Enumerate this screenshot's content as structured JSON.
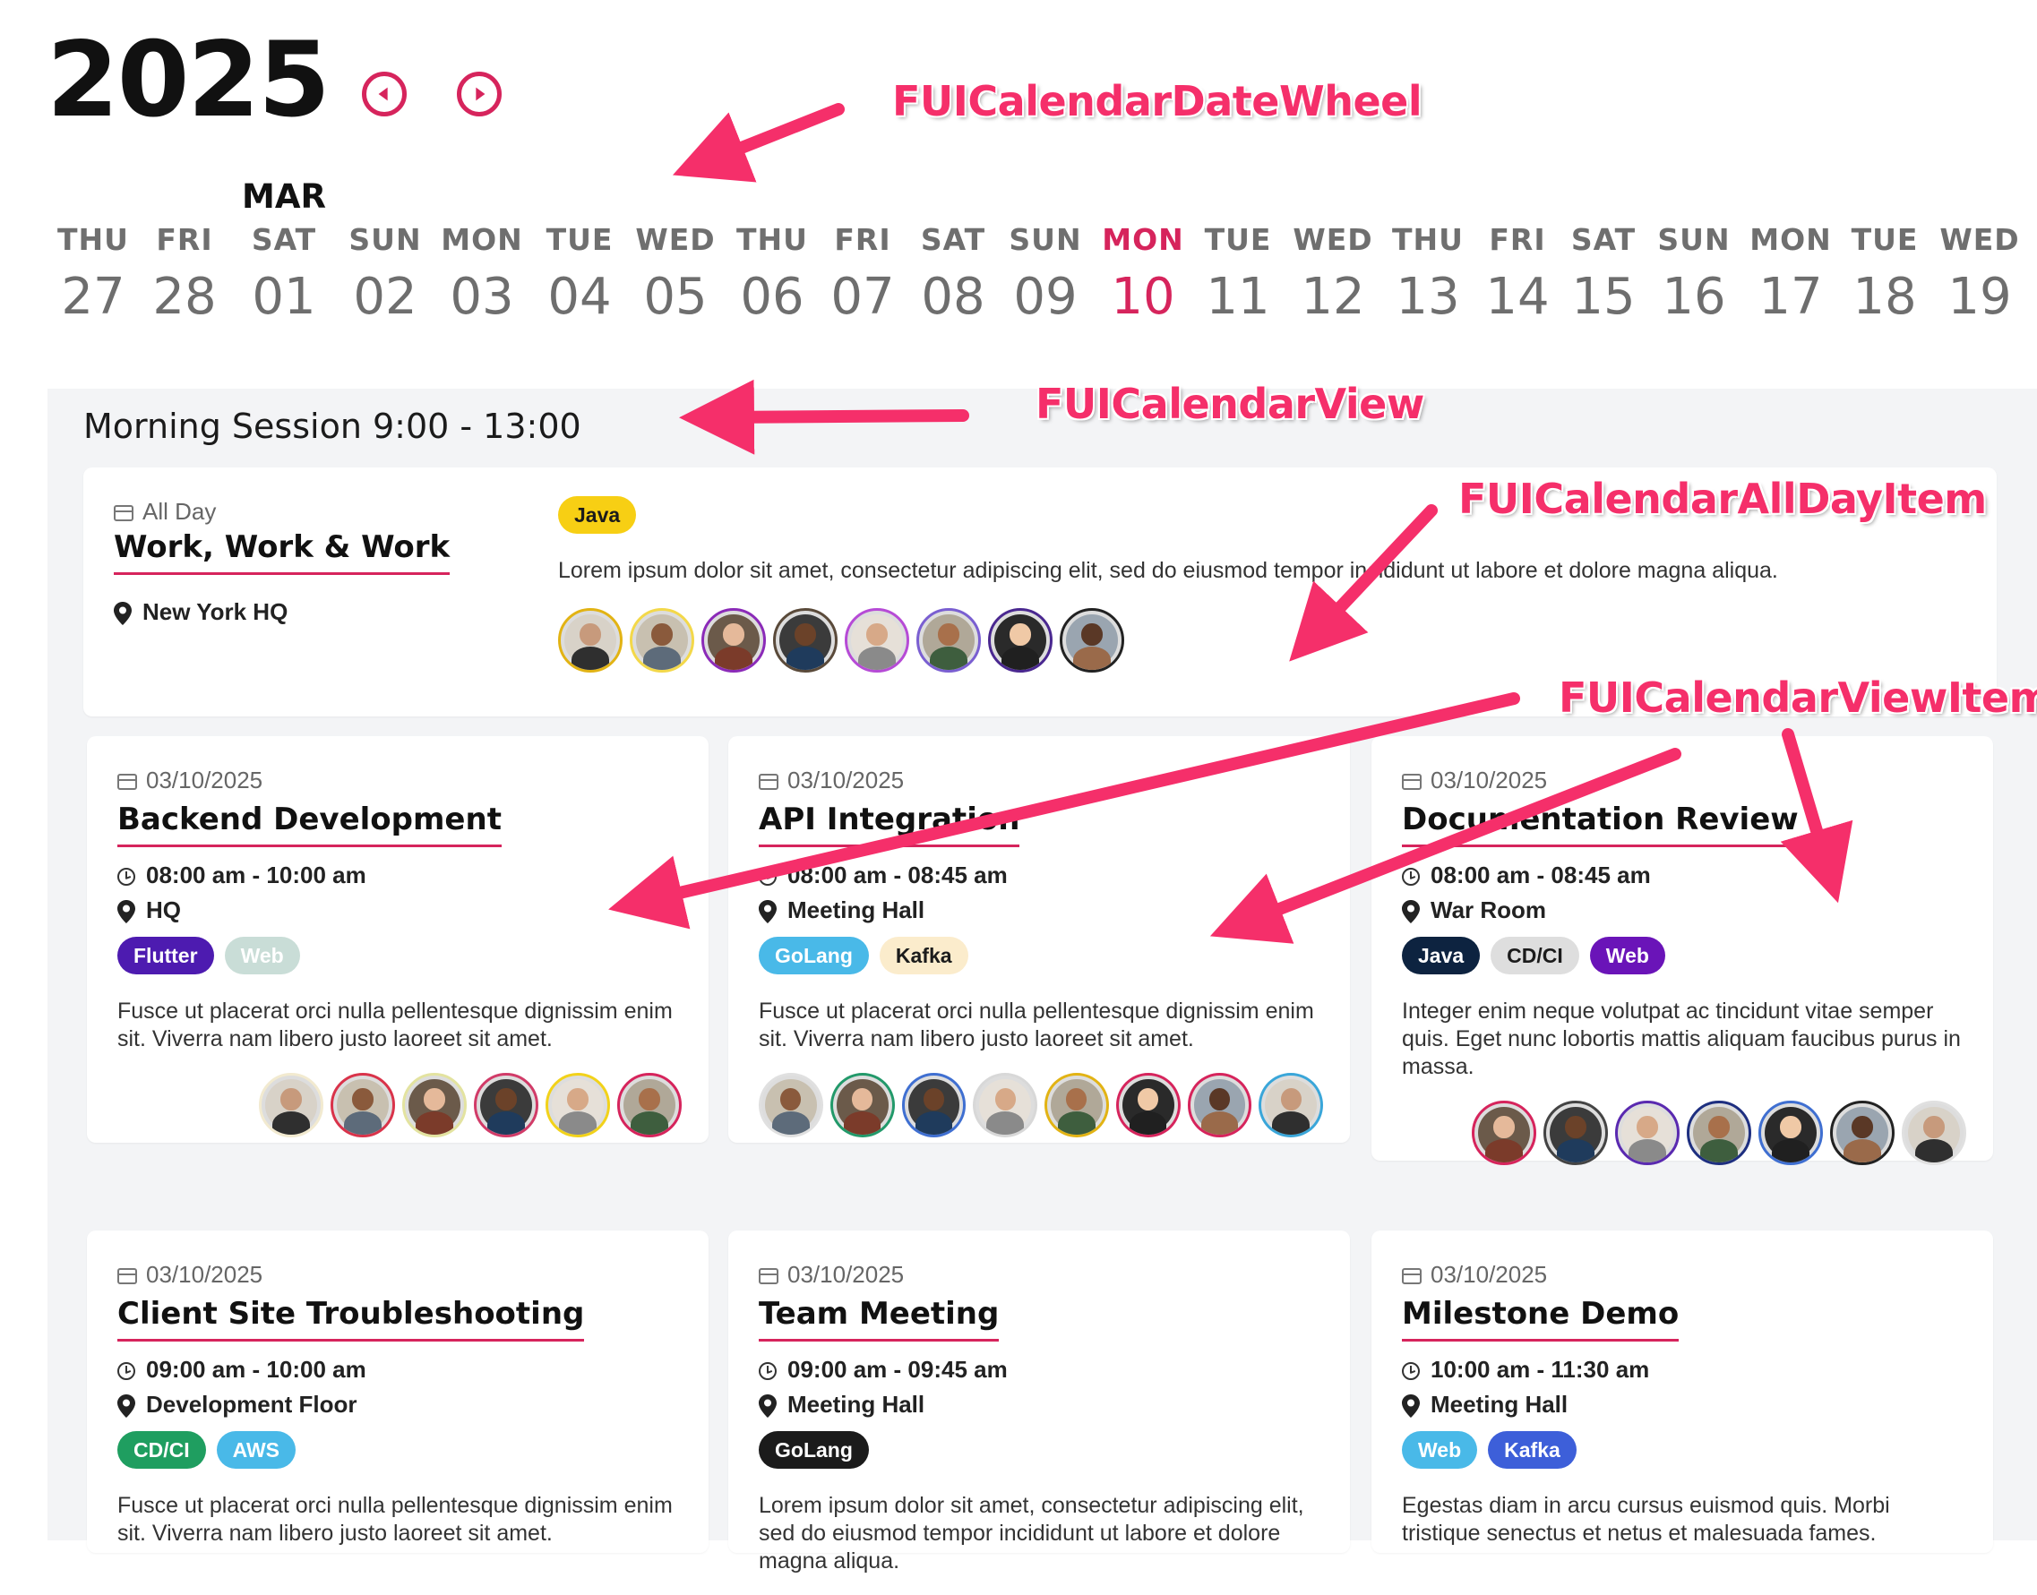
{
  "header": {
    "year": "2025",
    "prev_icon": "chevron-left-circle-icon",
    "next_icon": "chevron-right-circle-icon"
  },
  "wheel": {
    "month_label": "MAR",
    "days": [
      {
        "name": "THU",
        "num": "27"
      },
      {
        "name": "FRI",
        "num": "28"
      },
      {
        "name": "SAT",
        "num": "01"
      },
      {
        "name": "SUN",
        "num": "02"
      },
      {
        "name": "MON",
        "num": "03"
      },
      {
        "name": "TUE",
        "num": "04"
      },
      {
        "name": "WED",
        "num": "05"
      },
      {
        "name": "THU",
        "num": "06"
      },
      {
        "name": "FRI",
        "num": "07"
      },
      {
        "name": "SAT",
        "num": "08"
      },
      {
        "name": "SUN",
        "num": "09"
      },
      {
        "name": "MON",
        "num": "10"
      },
      {
        "name": "TUE",
        "num": "11"
      },
      {
        "name": "WED",
        "num": "12"
      },
      {
        "name": "THU",
        "num": "13"
      },
      {
        "name": "FRI",
        "num": "14"
      },
      {
        "name": "SAT",
        "num": "15"
      },
      {
        "name": "SUN",
        "num": "16"
      },
      {
        "name": "MON",
        "num": "17"
      },
      {
        "name": "TUE",
        "num": "18"
      },
      {
        "name": "WED",
        "num": "19"
      }
    ],
    "selected_day": "10"
  },
  "view": {
    "session_title": "Morning Session 9:00 - 13:00",
    "all_day": {
      "label": "All Day",
      "title": "Work, Work & Work",
      "location": "New York HQ",
      "tag": {
        "label": "Java",
        "bg": "#f7cf14",
        "fg": "#1b1b1b"
      },
      "description": "Lorem ipsum dolor sit amet, consectetur adipiscing elit, sed do eiusmod tempor incididunt ut labore et dolore magna aliqua.",
      "avatar_borders": [
        "#e2b314",
        "#f3d84a",
        "#8b2bb8",
        "#5a4a3a",
        "#b64bd6",
        "#7a5fd1",
        "#4a2890",
        "#222222"
      ]
    },
    "items": [
      {
        "date": "03/10/2025",
        "title": "Backend Development",
        "time": "08:00 am - 10:00 am",
        "location": "HQ",
        "tags": [
          {
            "label": "Flutter",
            "bg": "#4d1bb0",
            "fg": "#ffffff"
          },
          {
            "label": "Web",
            "bg": "#c9ddd7",
            "fg": "#ffffff"
          }
        ],
        "description": "Fusce ut placerat orci nulla pellentesque dignissim enim sit. Viverra nam libero justo laoreet sit amet.",
        "avatar_borders": [
          "#f2ead0",
          "#d9334a",
          "#e3e3a0",
          "#d13b68",
          "#f2d21a",
          "#d6245c"
        ]
      },
      {
        "date": "03/10/2025",
        "title": "API Integration",
        "time": "08:00 am - 08:45 am",
        "location": "Meeting Hall",
        "tags": [
          {
            "label": "GoLang",
            "bg": "#49b9e8",
            "fg": "#ffffff"
          },
          {
            "label": "Kafka",
            "bg": "#fbeccc",
            "fg": "#1b1b1b"
          }
        ],
        "description": "Fusce ut placerat orci nulla pellentesque dignissim enim sit. Viverra nam libero justo laoreet sit amet.",
        "avatar_borders": [
          "#e0e0e0",
          "#22996a",
          "#3f6fd1",
          "#d8d8d8",
          "#e2b314",
          "#d6245c",
          "#d6245c",
          "#3aa6d9"
        ]
      },
      {
        "date": "03/10/2025",
        "title": "Documentation Review",
        "time": "08:00 am - 08:45 am",
        "location": "War Room",
        "tags": [
          {
            "label": "Java",
            "bg": "#0d2340",
            "fg": "#ffffff"
          },
          {
            "label": "CD/CI",
            "bg": "#dedede",
            "fg": "#1b1b1b"
          },
          {
            "label": "Web",
            "bg": "#6a14b8",
            "fg": "#ffffff"
          }
        ],
        "description": "Integer enim neque volutpat ac tincidunt vitae semper quis. Eget nunc lobortis mattis aliquam faucibus purus in massa.",
        "avatar_borders": [
          "#d6245c",
          "#444444",
          "#5a2ab0",
          "#1e2f80",
          "#3f6fd1",
          "#222222",
          "#e0e0e0"
        ]
      },
      {
        "date": "03/10/2025",
        "title": "Client Site Troubleshooting",
        "time": "09:00 am - 10:00 am",
        "location": "Development Floor",
        "tags": [
          {
            "label": "CD/CI",
            "bg": "#1f9e60",
            "fg": "#ffffff"
          },
          {
            "label": "AWS",
            "bg": "#49b9e8",
            "fg": "#ffffff"
          }
        ],
        "description": "Fusce ut placerat orci nulla pellentesque dignissim enim sit. Viverra nam libero justo laoreet sit amet.",
        "avatar_borders": []
      },
      {
        "date": "03/10/2025",
        "title": "Team Meeting",
        "time": "09:00 am - 09:45 am",
        "location": "Meeting Hall",
        "tags": [
          {
            "label": "GoLang",
            "bg": "#1b1b1b",
            "fg": "#ffffff"
          }
        ],
        "description": "Lorem ipsum dolor sit amet, consectetur adipiscing elit, sed do eiusmod tempor incididunt ut labore et dolore magna aliqua.",
        "avatar_borders": []
      },
      {
        "date": "03/10/2025",
        "title": "Milestone Demo",
        "time": "10:00 am - 11:30 am",
        "location": "Meeting Hall",
        "tags": [
          {
            "label": "Web",
            "bg": "#49b9e8",
            "fg": "#ffffff"
          },
          {
            "label": "Kafka",
            "bg": "#3d5fd9",
            "fg": "#ffffff"
          }
        ],
        "description": "Egestas diam in arcu cursus euismod quis. Morbi tristique senectus et netus et malesuada fames.",
        "avatar_borders": []
      }
    ]
  },
  "annotations": {
    "date_wheel": "FUICalendarDateWheel",
    "view": "FUICalendarView",
    "all_day_item": "FUICalendarAllDayItem",
    "view_item": "FUICalendarViewItem"
  },
  "colors": {
    "accent": "#d6245c",
    "annotation": "#f52f6a",
    "view_bg": "#f3f4f6"
  }
}
